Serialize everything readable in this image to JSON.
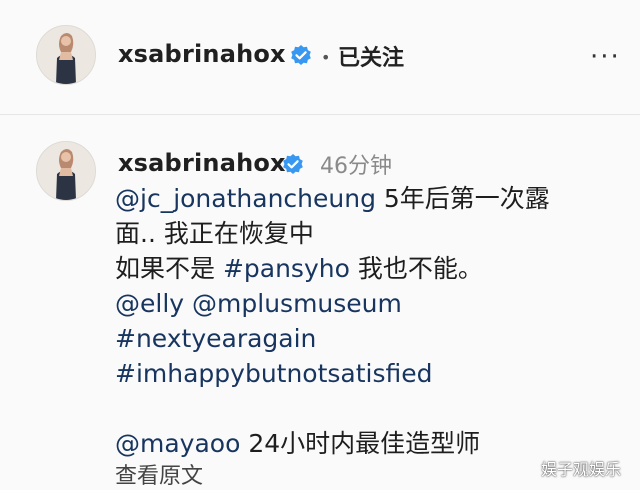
{
  "post_header": {
    "username": "xsabrinahox",
    "follow_label": "已关注",
    "separator": "•",
    "more_label": "···"
  },
  "comment": {
    "username": "xsabrinahox",
    "time": "46分钟",
    "line1_mention": "@jc_jonathancheung",
    "line1_text": " 5年后第一次露",
    "line2_text": "面.. 我正在恢复中",
    "line3_text_a": "如果不是 ",
    "line3_hashtag": "#pansyho",
    "line3_text_b": " 我也不能。",
    "line4_mention_a": "@elly",
    "line4_mention_b": "@mplusmuseum",
    "line5_hashtag": "#nextyearagain",
    "line6_hashtag": "#imhappybutnotsatisfied",
    "line7_mention": "@mayaoo",
    "line7_text": " 24小时内最佳造型师",
    "see_original": "查看原文"
  },
  "watermark": "娱子观娱乐",
  "colors": {
    "link": "#17355f",
    "verified": "#3897f0",
    "muted": "#8a8a8a"
  }
}
